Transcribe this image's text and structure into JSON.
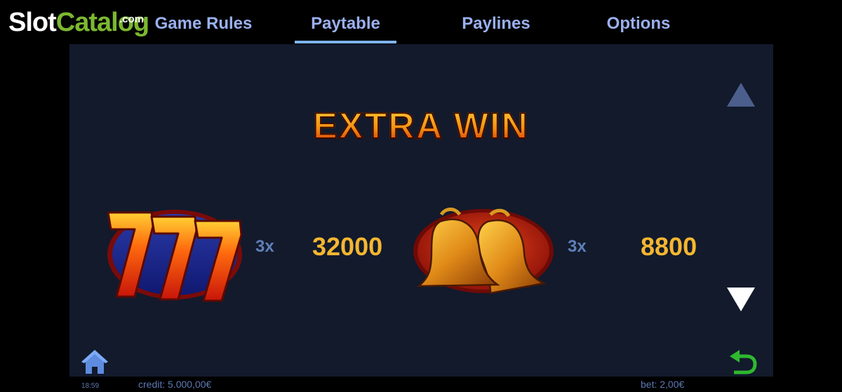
{
  "logo": {
    "part1": "Slot",
    "part2": "Catalog",
    "suffix": ".com"
  },
  "tabs": [
    {
      "label": "Game Rules"
    },
    {
      "label": "Paytable"
    },
    {
      "label": "Paylines"
    },
    {
      "label": "Options"
    }
  ],
  "active_tab": "Paytable",
  "section_title": "EXTRA WIN",
  "paytable": [
    {
      "symbol": "triple-seven-icon",
      "count": "3x",
      "payout": "32000"
    },
    {
      "symbol": "bells-icon",
      "count": "3x",
      "payout": "8800"
    }
  ],
  "footer": {
    "clock": "18:59",
    "credit": "credit: 5.000,00€",
    "bet": "bet: 2,00€"
  },
  "colors": {
    "panel": "#121a2c",
    "tab_text": "#9ab0ee",
    "tab_underline": "#7eb4f2",
    "payout": "#f5b630",
    "count": "#5f7fb8",
    "back_icon": "#2fb82f"
  }
}
